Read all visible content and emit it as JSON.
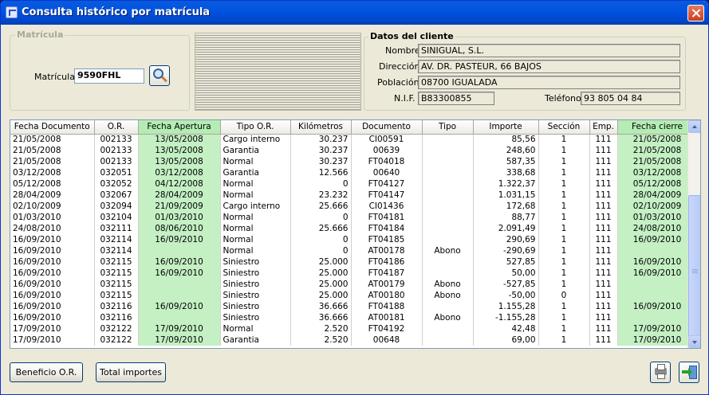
{
  "window": {
    "title": "Consulta histórico por matrícula"
  },
  "matricula_group": {
    "title": "Matrícula",
    "label": "Matrícula",
    "value": "9590FHL"
  },
  "cliente": {
    "title": "Datos del cliente",
    "nombre_label": "Nombre",
    "nombre": "SINIGUAL, S.L.",
    "direccion_label": "Dirección",
    "direccion": "AV. DR. PASTEUR, 66 BAJOS",
    "poblacion_label": "Población",
    "poblacion": "08700 IGUALADA",
    "nif_label": "N.I.F.",
    "nif": "B83300855",
    "telefono_label": "Teléfono",
    "telefono": "93 805 04 84"
  },
  "grid": {
    "columns": [
      "Fecha Documento",
      "O.R.",
      "Fecha  Apertura",
      "Tipo O.R.",
      "Kilómetros",
      "Documento",
      "Tipo",
      "Importe",
      "Sección",
      "Emp.",
      "Fecha cierre"
    ],
    "rows": [
      [
        "21/05/2008",
        "002133",
        "13/05/2008",
        "Cargo interno",
        "30.237",
        "CI00591",
        "",
        "85,56",
        "1",
        "111",
        "21/05/2008"
      ],
      [
        "21/05/2008",
        "002133",
        "13/05/2008",
        "Garantia",
        "30.237",
        "00639",
        "",
        "248,60",
        "1",
        "111",
        "21/05/2008"
      ],
      [
        "21/05/2008",
        "002133",
        "13/05/2008",
        "Normal",
        "30.237",
        "FT04018",
        "",
        "587,35",
        "1",
        "111",
        "21/05/2008"
      ],
      [
        "03/12/2008",
        "032051",
        "03/12/2008",
        "Garantia",
        "12.566",
        "00640",
        "",
        "338,68",
        "1",
        "111",
        "03/12/2008"
      ],
      [
        "05/12/2008",
        "032052",
        "04/12/2008",
        "Normal",
        "0",
        "FT04127",
        "",
        "1.322,37",
        "1",
        "111",
        "05/12/2008"
      ],
      [
        "28/04/2009",
        "032067",
        "28/04/2009",
        "Normal",
        "23.232",
        "FT04147",
        "",
        "1.031,15",
        "1",
        "111",
        "28/04/2009"
      ],
      [
        "02/10/2009",
        "032094",
        "21/09/2009",
        "Cargo interno",
        "25.666",
        "CI01436",
        "",
        "172,68",
        "1",
        "111",
        "02/10/2009"
      ],
      [
        "01/03/2010",
        "032104",
        "01/03/2010",
        "Normal",
        "0",
        "FT04181",
        "",
        "88,77",
        "1",
        "111",
        "01/03/2010"
      ],
      [
        "24/08/2010",
        "032111",
        "08/06/2010",
        "Normal",
        "25.666",
        "FT04184",
        "",
        "2.091,49",
        "1",
        "111",
        "24/08/2010"
      ],
      [
        "16/09/2010",
        "032114",
        "16/09/2010",
        "Normal",
        "0",
        "FT04185",
        "",
        "290,69",
        "1",
        "111",
        "16/09/2010"
      ],
      [
        "16/09/2010",
        "032114",
        "",
        "Normal",
        "0",
        "AT00178",
        "Abono",
        "-290,69",
        "1",
        "111",
        ""
      ],
      [
        "16/09/2010",
        "032115",
        "16/09/2010",
        "Siniestro",
        "25.000",
        "FT04186",
        "",
        "527,85",
        "1",
        "111",
        "16/09/2010"
      ],
      [
        "16/09/2010",
        "032115",
        "16/09/2010",
        "Siniestro",
        "25.000",
        "FT04187",
        "",
        "50,00",
        "1",
        "111",
        "16/09/2010"
      ],
      [
        "16/09/2010",
        "032115",
        "",
        "Siniestro",
        "25.000",
        "AT00179",
        "Abono",
        "-527,85",
        "1",
        "111",
        ""
      ],
      [
        "16/09/2010",
        "032115",
        "",
        "Siniestro",
        "25.000",
        "AT00180",
        "Abono",
        "-50,00",
        "0",
        "111",
        ""
      ],
      [
        "16/09/2010",
        "032116",
        "16/09/2010",
        "Siniestro",
        "36.666",
        "FT04188",
        "",
        "1.155,28",
        "1",
        "111",
        "16/09/2010"
      ],
      [
        "16/09/2010",
        "032116",
        "",
        "Siniestro",
        "36.666",
        "AT00181",
        "Abono",
        "-1.155,28",
        "1",
        "111",
        ""
      ],
      [
        "17/09/2010",
        "032122",
        "17/09/2010",
        "Normal",
        "2.520",
        "FT04192",
        "",
        "42,48",
        "1",
        "111",
        "17/09/2010"
      ],
      [
        "17/09/2010",
        "032122",
        "17/09/2010",
        "Garantia",
        "2.520",
        "00648",
        "",
        "69,00",
        "1",
        "111",
        "17/09/2010"
      ]
    ]
  },
  "buttons": {
    "beneficio": "Beneficio O.R.",
    "total": "Total importes",
    "print_icon": "printer-icon",
    "exit_icon": "exit-door-icon"
  },
  "colors": {
    "title_bar": "#0054e3",
    "highlight_column": "#c4f0c4"
  }
}
